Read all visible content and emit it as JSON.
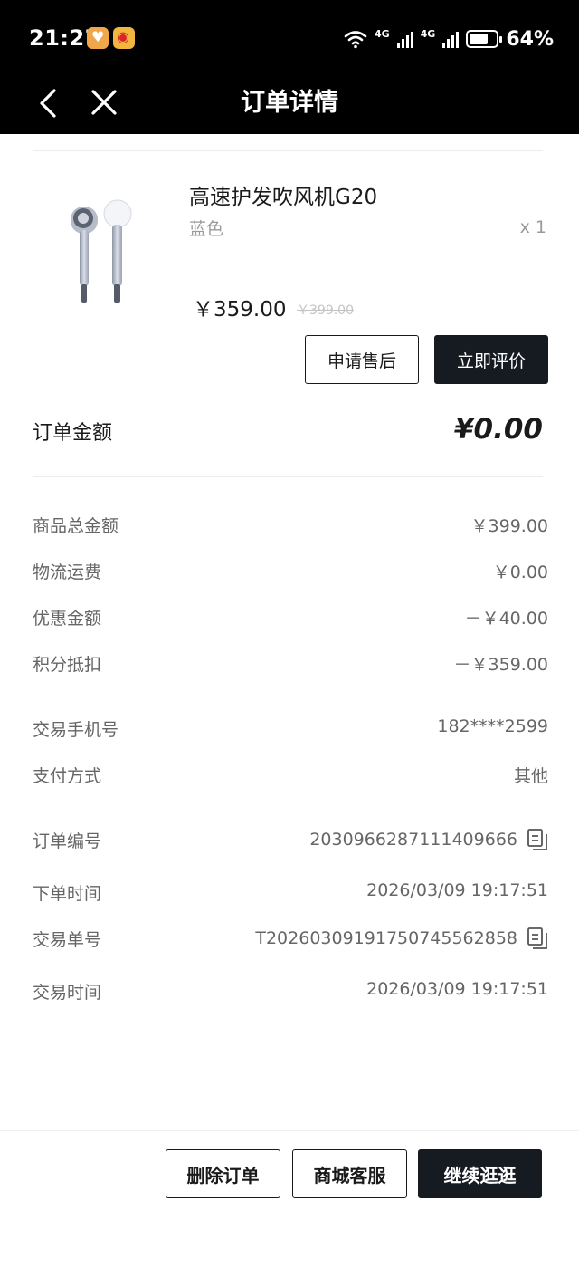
{
  "status_bar": {
    "time": "21:27",
    "network_1": "4G",
    "network_2": "4G",
    "battery": "64%"
  },
  "header": {
    "title": "订单详情",
    "back_icon": "chevron-left-icon",
    "close_icon": "close-icon"
  },
  "product": {
    "name": "高速护发吹风机G20",
    "variant": "蓝色",
    "quantity": "x 1",
    "price": "￥359.00",
    "original_price": "￥399.00",
    "image_icon": "hair-dryer-image"
  },
  "actions": {
    "after_sale": "申请售后",
    "review": "立即评价"
  },
  "order_total": {
    "label": "订单金额",
    "value": "¥0.00"
  },
  "summary": [
    {
      "label": "商品总金额",
      "value": "￥399.00"
    },
    {
      "label": "物流运费",
      "value": "￥0.00"
    },
    {
      "label": "优惠金额",
      "value": "－￥40.00"
    },
    {
      "label": "积分抵扣",
      "value": "－￥359.00"
    }
  ],
  "payment": [
    {
      "label": "交易手机号",
      "value": "182****2599"
    },
    {
      "label": "支付方式",
      "value": "其他"
    }
  ],
  "order_info": [
    {
      "label": "订单编号",
      "value": "2030966287111409666"
    },
    {
      "label": "下单时间",
      "value": "2026/03/09 19:17:51"
    },
    {
      "label": "交易单号",
      "value": "T2026030919175074556285​8"
    },
    {
      "label": "交易时间",
      "value": "2026/03/09 19:17:51"
    }
  ],
  "bottom_bar": {
    "delete": "删除订单",
    "service": "商城客服",
    "continue": "继续逛逛"
  },
  "colors": {
    "header_bg": "#000000",
    "dark_button": "#161a21",
    "muted_text": "#666666",
    "light_text": "#9a9a9a"
  }
}
